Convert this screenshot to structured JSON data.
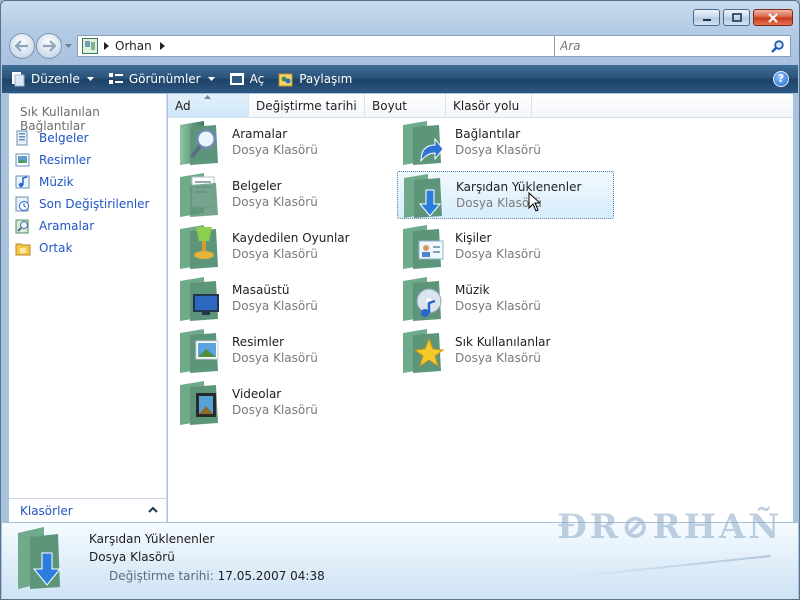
{
  "address": {
    "crumb": "Orhan"
  },
  "search": {
    "placeholder": "Ara"
  },
  "toolbar": {
    "organize_label": "Düzenle",
    "views_label": "Görünümler",
    "open_label": "Aç",
    "share_label": "Paylaşım",
    "help_label": "?"
  },
  "navigation": {
    "heading": "Sık Kullanılan Bağlantılar",
    "links": [
      {
        "label": "Belgeler",
        "icon": "documents-icon"
      },
      {
        "label": "Resimler",
        "icon": "pictures-icon"
      },
      {
        "label": "Müzik",
        "icon": "music-icon"
      },
      {
        "label": "Son Değiştirilenler",
        "icon": "recent-icon"
      },
      {
        "label": "Aramalar",
        "icon": "searches-icon"
      },
      {
        "label": "Ortak",
        "icon": "public-icon"
      }
    ],
    "folders_label": "Klasörler"
  },
  "columns": [
    "Ad",
    "Değiştirme tarihi",
    "Boyut",
    "Klasör yolu"
  ],
  "items": [
    {
      "name": "Aramalar",
      "type": "Dosya Klasörü",
      "icon": "search-folder-icon"
    },
    {
      "name": "Bağlantılar",
      "type": "Dosya Klasörü",
      "icon": "links-folder-icon"
    },
    {
      "name": "Belgeler",
      "type": "Dosya Klasörü",
      "icon": "documents-folder-icon"
    },
    {
      "name": "Karşıdan Yüklenenler",
      "type": "Dosya Klasörü",
      "icon": "downloads-folder-icon",
      "selected": true
    },
    {
      "name": "Kaydedilen Oyunlar",
      "type": "Dosya Klasörü",
      "icon": "saved-games-folder-icon"
    },
    {
      "name": "Kişiler",
      "type": "Dosya Klasörü",
      "icon": "contacts-folder-icon"
    },
    {
      "name": "Masaüstü",
      "type": "Dosya Klasörü",
      "icon": "desktop-folder-icon"
    },
    {
      "name": "Müzik",
      "type": "Dosya Klasörü",
      "icon": "music-folder-icon"
    },
    {
      "name": "Resimler",
      "type": "Dosya Klasörü",
      "icon": "pictures-folder-icon"
    },
    {
      "name": "Sık Kullanılanlar",
      "type": "Dosya Klasörü",
      "icon": "favorites-folder-icon"
    },
    {
      "name": "Videolar",
      "type": "Dosya Klasörü",
      "icon": "videos-folder-icon"
    }
  ],
  "details": {
    "name": "Karşıdan Yüklenenler",
    "type": "Dosya Klasörü",
    "modified_label": "Değiştirme tarihi:",
    "modified_value": "17.05.2007 04:38"
  },
  "watermark": "ÐR⊘RHAÑ"
}
